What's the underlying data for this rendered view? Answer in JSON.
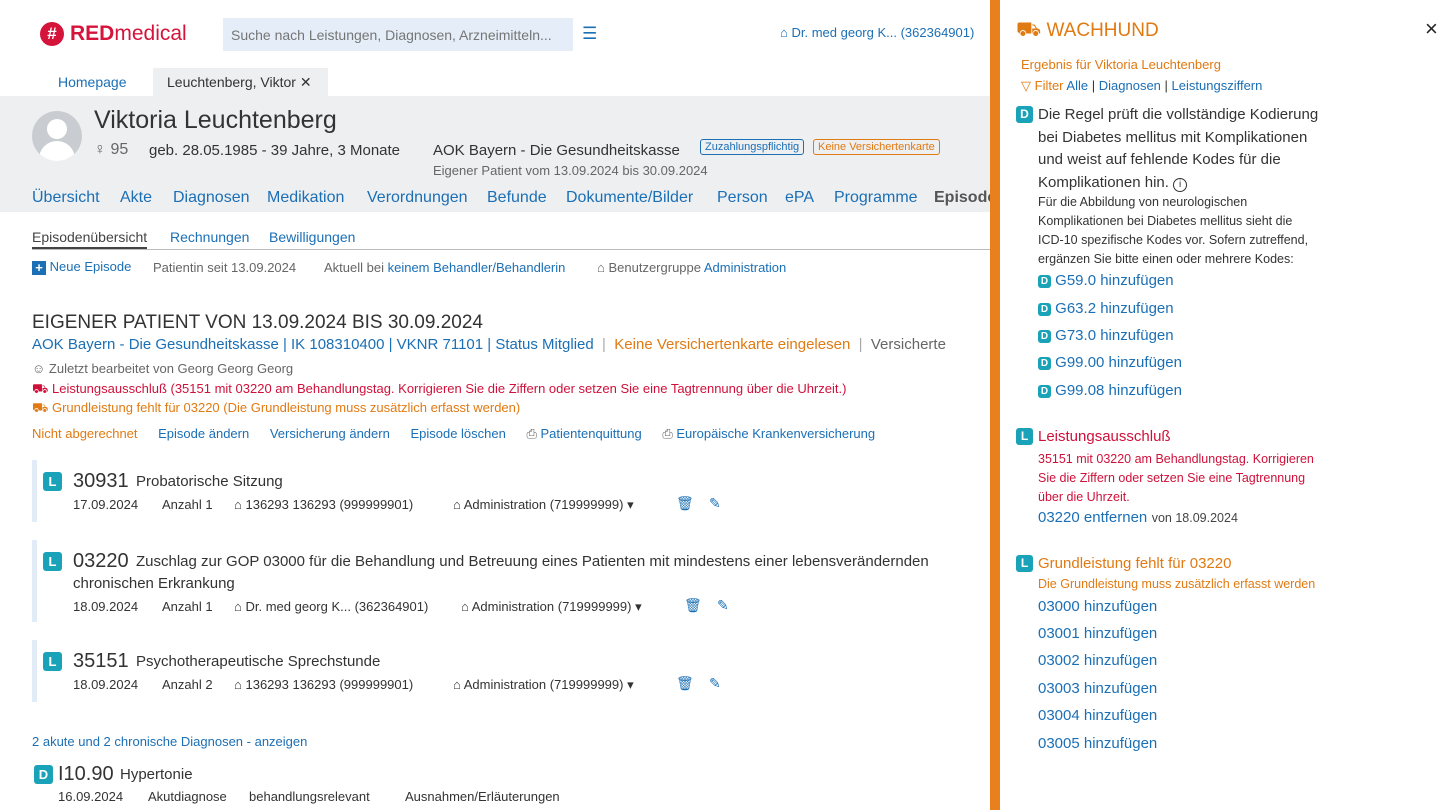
{
  "header": {
    "logo_text_red": "RED",
    "logo_text_rest": " medical",
    "search_placeholder": "Suche nach Leistungen, Diagnosen, Arzneimitteln...",
    "doctor": "Dr. med georg K... (362364901)"
  },
  "tabs": [
    {
      "label": "Homepage"
    },
    {
      "label": "Leuchtenberg, Viktor"
    }
  ],
  "patient": {
    "name": "Viktoria Leuchtenberg",
    "gender_num": "95",
    "birth": "geb. 28.05.1985 - 39 Jahre, 3 Monate",
    "insurance": "AOK Bayern - Die Gesundheitskasse",
    "badge1": "Zuzahlungspflichtig",
    "badge2": "Keine Versichertenkarte",
    "own_patient": "Eigener Patient vom 13.09.2024 bis 30.09.2024"
  },
  "nav": [
    "Übersicht",
    "Akte",
    "Diagnosen",
    "Medikation",
    "Verordnungen",
    "Befunde",
    "Dokumente/Bilder",
    "Person",
    "ePA",
    "Programme",
    "Episode"
  ],
  "subnav": [
    "Episodenübersicht",
    "Rechnungen",
    "Bewilligungen"
  ],
  "toolbar": {
    "new_episode": "Neue Episode",
    "since": "Patientin seit 13.09.2024",
    "current_prefix": "Aktuell bei ",
    "current_link": "keinem Behandler/Behandlerin",
    "group_prefix": "Benutzergruppe ",
    "group_link": "Administration"
  },
  "episode": {
    "title": "EIGENER PATIENT VON 13.09.2024 BIS 30.09.2024",
    "insurance_line": "AOK Bayern - Die Gesundheitskasse | IK 108310400 | VKNR 71101 | Status Mitglied",
    "card_warning": "Keine Versichertenkarte eingelesen",
    "insured_trunc": "Versicherte",
    "last_edited": "Zuletzt bearbeitet von Georg Georg Georg",
    "warning1": "Leistungsausschluß (35151 mit 03220 am Behandlungstag. Korrigieren Sie die Ziffern oder setzen Sie eine Tagtrennung über die Uhrzeit.)",
    "warning2": "Grundleistung fehlt für 03220 (Die Grundleistung muss zusätzlich erfasst werden)",
    "actions": {
      "not_billed": "Nicht abgerechnet",
      "edit": "Episode ändern",
      "insurance": "Versicherung ändern",
      "delete": "Episode löschen",
      "receipt": "Patientenquittung",
      "eu": "Europäische Krankenversicherung"
    }
  },
  "services": [
    {
      "badge": "L",
      "code": "30931",
      "desc": "Probatorische Sitzung",
      "desc2": "",
      "date": "17.09.2024",
      "count": "Anzahl 1",
      "provider": "136293 136293 (999999901)",
      "admin": "Administration (719999999)"
    },
    {
      "badge": "L",
      "code": "03220",
      "desc": "Zuschlag zur GOP 03000 für die Behandlung und Betreuung eines Patienten mit mindestens einer lebensverändernden",
      "desc2": "chronischen Erkrankung",
      "date": "18.09.2024",
      "count": "Anzahl 1",
      "provider": "Dr. med georg K... (362364901)",
      "admin": "Administration (719999999)"
    },
    {
      "badge": "L",
      "code": "35151",
      "desc": "Psychotherapeutische Sprechstunde",
      "desc2": "",
      "date": "18.09.2024",
      "count": "Anzahl 2",
      "provider": "136293 136293 (999999901)",
      "admin": "Administration (719999999)"
    }
  ],
  "diagnoses": {
    "toggle": "2 akute und 2 chronische Diagnosen - anzeigen",
    "first": {
      "badge": "D",
      "code": "I10.90",
      "desc": "Hypertonie",
      "date": "16.09.2024",
      "type": "Akutdiagnose",
      "link1": "behandlungsrelevant",
      "link2": "Ausnahmen/Erläuterungen"
    }
  },
  "panel": {
    "title": "WACHHUND",
    "close": "×",
    "result": "Ergebnis für Viktoria Leuchtenberg",
    "filter_label": "Filter",
    "filter_all": "Alle",
    "filter_diag": "Diagnosen",
    "filter_ls": "Leistungsziffern",
    "rule1": {
      "badge": "D",
      "lines": [
        "Die Regel prüft die vollständige Kodierung",
        "bei Diabetes mellitus mit Komplikationen",
        "und weist auf fehlende Kodes für die",
        "Komplikationen hin."
      ],
      "small": [
        "Für die Abbildung von neurologischen",
        "Komplikationen bei Diabetes mellitus sieht die",
        "ICD-10 spezifische Kodes vor. Sofern zutreffend,",
        "ergänzen Sie bitte einen oder mehrere Kodes:"
      ],
      "items": [
        "G59.0 hinzufügen",
        "G63.2 hinzufügen",
        "G73.0 hinzufügen",
        "G99.00 hinzufügen",
        "G99.08 hinzufügen"
      ]
    },
    "rule2": {
      "badge": "L",
      "title": "Leistungsausschluß",
      "lines": [
        "35151 mit 03220 am Behandlungstag. Korrigieren",
        "Sie die Ziffern oder setzen Sie eine Tagtrennung",
        "über die Uhrzeit."
      ],
      "action": "03220 entfernen",
      "action_suffix": "von 18.09.2024"
    },
    "rule3": {
      "badge": "L",
      "title": "Grundleistung fehlt für 03220",
      "sub": "Die Grundleistung muss zusätzlich erfasst werden",
      "items": [
        "03000 hinzufügen",
        "03001 hinzufügen",
        "03002 hinzufügen",
        "03003 hinzufügen",
        "03004 hinzufügen",
        "03005 hinzufügen"
      ]
    }
  }
}
